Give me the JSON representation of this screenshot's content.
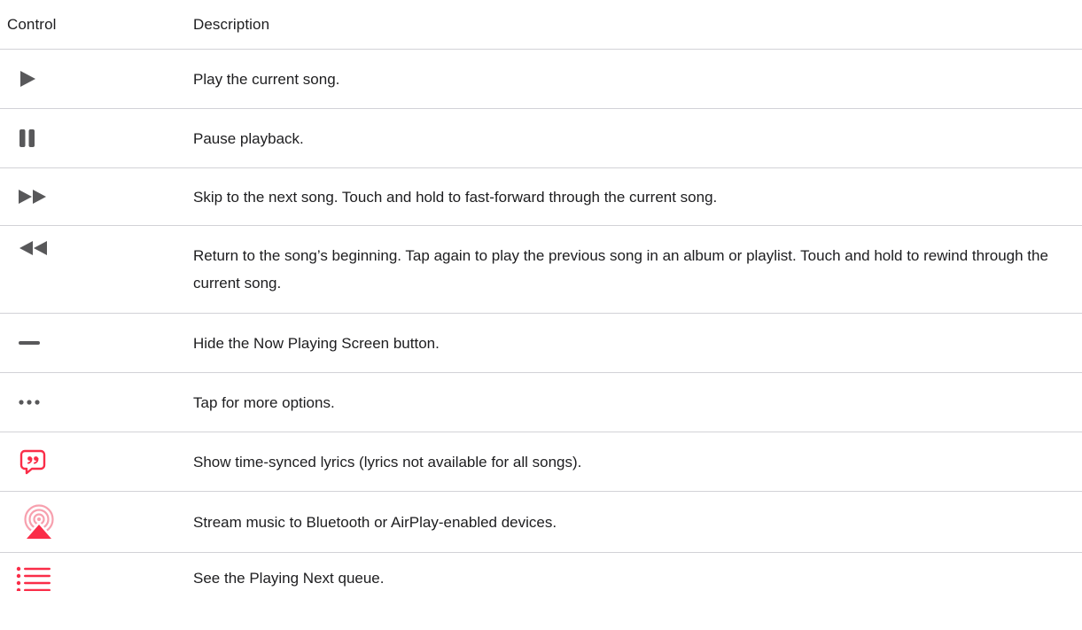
{
  "header": {
    "control": "Control",
    "description": "Description"
  },
  "rows": [
    {
      "icon": "play-icon",
      "description": "Play the current song."
    },
    {
      "icon": "pause-icon",
      "description": "Pause playback."
    },
    {
      "icon": "fast-forward-icon",
      "description": "Skip to the next song. Touch and hold to fast-forward through the current song."
    },
    {
      "icon": "rewind-icon",
      "description": "Return to the song’s beginning. Tap again to play the previous song in an album or playlist. Touch and hold to rewind through the current song."
    },
    {
      "icon": "minimize-bar-icon",
      "description": "Hide the Now Playing Screen button."
    },
    {
      "icon": "more-options-icon",
      "description": "Tap for more options."
    },
    {
      "icon": "lyrics-icon",
      "description": "Show time-synced lyrics (lyrics not available for all songs)."
    },
    {
      "icon": "airplay-icon",
      "description": "Stream music to Bluetooth or AirPlay-enabled devices."
    },
    {
      "icon": "playing-next-queue-icon",
      "description": "See the Playing Next queue."
    }
  ],
  "colors": {
    "icon_gray": "#58585a",
    "accent": "#fa2d48",
    "divider": "#d2d2d7"
  }
}
